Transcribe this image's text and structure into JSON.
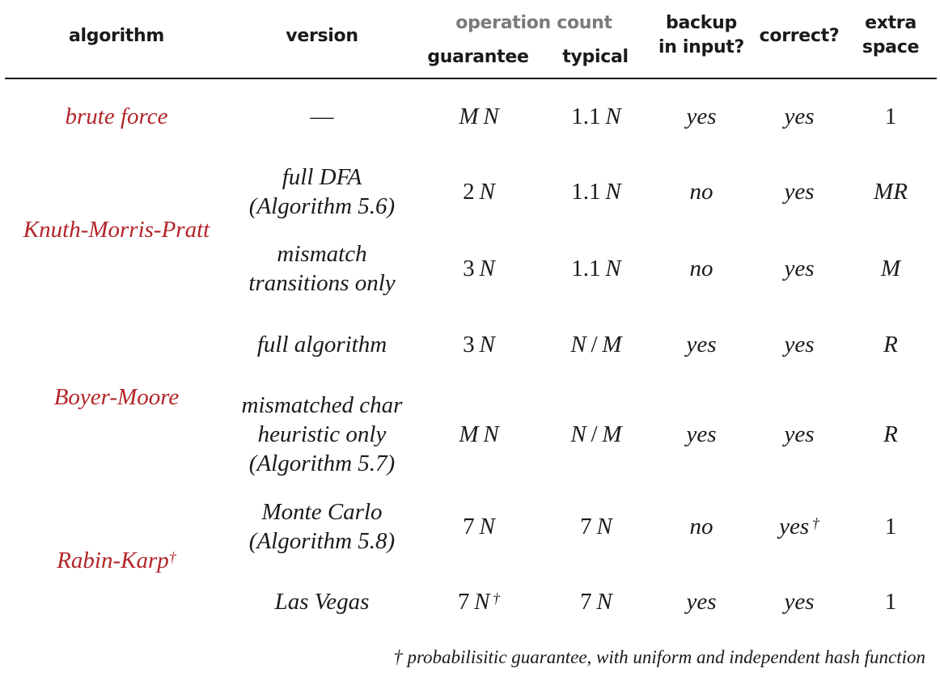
{
  "header": {
    "algorithm": "algorithm",
    "version": "version",
    "operation_count": "operation count",
    "guarantee": "guarantee",
    "typical": "typical",
    "backup_line1": "backup",
    "backup_line2": "in input?",
    "correct": "correct?",
    "extra_line1": "extra",
    "extra_line2": "space"
  },
  "colors": {
    "algorithm_name": "#b3242a",
    "group_header": "#7a7a7a",
    "text": "#1a1a1a"
  },
  "algorithms": {
    "brute_force": "brute force",
    "kmp": "Knuth-Morris-Pratt",
    "boyer_moore": "Boyer-Moore",
    "rabin_karp": "Rabin-Karp",
    "rabin_karp_mark": "†"
  },
  "rows": [
    {
      "version": [
        "—"
      ],
      "guarantee": "M N",
      "guarantee_mark": "",
      "typical": "1.1 N",
      "backup": "yes",
      "correct": "yes",
      "correct_mark": "",
      "space": "1"
    },
    {
      "version": [
        "full DFA",
        "(Algorithm 5.6)"
      ],
      "guarantee": "2 N",
      "guarantee_mark": "",
      "typical": "1.1 N",
      "backup": "no",
      "correct": "yes",
      "correct_mark": "",
      "space": "MR"
    },
    {
      "version": [
        "mismatch",
        "transitions only"
      ],
      "guarantee": "3 N",
      "guarantee_mark": "",
      "typical": "1.1 N",
      "backup": "no",
      "correct": "yes",
      "correct_mark": "",
      "space": "M"
    },
    {
      "version": [
        "full algorithm"
      ],
      "guarantee": "3 N",
      "guarantee_mark": "",
      "typical": "N / M",
      "backup": "yes",
      "correct": "yes",
      "correct_mark": "",
      "space": "R"
    },
    {
      "version": [
        "mismatched char",
        "heuristic only",
        "(Algorithm 5.7)"
      ],
      "guarantee": "M N",
      "guarantee_mark": "",
      "typical": "N / M",
      "backup": "yes",
      "correct": "yes",
      "correct_mark": "",
      "space": "R"
    },
    {
      "version": [
        "Monte Carlo",
        "(Algorithm 5.8)"
      ],
      "guarantee": "7 N",
      "guarantee_mark": "",
      "typical": "7 N",
      "backup": "no",
      "correct": "yes",
      "correct_mark": "†",
      "space": "1"
    },
    {
      "version": [
        "Las Vegas"
      ],
      "guarantee": "7 N",
      "guarantee_mark": "†",
      "typical": "7 N",
      "backup": "yes",
      "correct": "yes",
      "correct_mark": "",
      "space": "1"
    }
  ],
  "footnote": "† probabilisitic guarantee, with uniform and independent hash function"
}
